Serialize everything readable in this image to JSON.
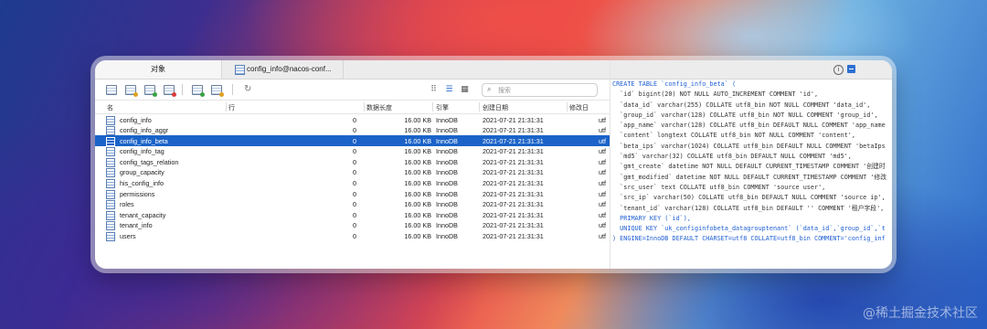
{
  "tabs": {
    "objects": "对象",
    "table_tab": "config_info@nacos-conf..."
  },
  "search": {
    "placeholder": "搜索"
  },
  "table": {
    "headers": {
      "name": "名",
      "rows": "行",
      "data_length": "数据长度",
      "engine": "引擎",
      "created": "创建日期",
      "modified": "修改日"
    },
    "rows": [
      {
        "name": "config_info",
        "rows": "0",
        "len": "16.00 KB",
        "engine": "InnoDB",
        "created": "2021-07-21 21:31:31",
        "mod": "utf"
      },
      {
        "name": "config_info_aggr",
        "rows": "0",
        "len": "16.00 KB",
        "engine": "InnoDB",
        "created": "2021-07-21 21:31:31",
        "mod": "utf"
      },
      {
        "name": "config_info_beta",
        "rows": "0",
        "len": "16.00 KB",
        "engine": "InnoDB",
        "created": "2021-07-21 21:31:31",
        "mod": "utf",
        "selected": true
      },
      {
        "name": "config_info_tag",
        "rows": "0",
        "len": "16.00 KB",
        "engine": "InnoDB",
        "created": "2021-07-21 21:31:31",
        "mod": "utf"
      },
      {
        "name": "config_tags_relation",
        "rows": "0",
        "len": "16.00 KB",
        "engine": "InnoDB",
        "created": "2021-07-21 21:31:31",
        "mod": "utf"
      },
      {
        "name": "group_capacity",
        "rows": "0",
        "len": "16.00 KB",
        "engine": "InnoDB",
        "created": "2021-07-21 21:31:31",
        "mod": "utf"
      },
      {
        "name": "his_config_info",
        "rows": "0",
        "len": "16.00 KB",
        "engine": "InnoDB",
        "created": "2021-07-21 21:31:31",
        "mod": "utf"
      },
      {
        "name": "permissions",
        "rows": "0",
        "len": "16.00 KB",
        "engine": "InnoDB",
        "created": "2021-07-21 21:31:31",
        "mod": "utf"
      },
      {
        "name": "roles",
        "rows": "0",
        "len": "16.00 KB",
        "engine": "InnoDB",
        "created": "2021-07-21 21:31:31",
        "mod": "utf"
      },
      {
        "name": "tenant_capacity",
        "rows": "0",
        "len": "16.00 KB",
        "engine": "InnoDB",
        "created": "2021-07-21 21:31:31",
        "mod": "utf"
      },
      {
        "name": "tenant_info",
        "rows": "0",
        "len": "16.00 KB",
        "engine": "InnoDB",
        "created": "2021-07-21 21:31:31",
        "mod": "utf"
      },
      {
        "name": "users",
        "rows": "0",
        "len": "16.00 KB",
        "engine": "InnoDB",
        "created": "2021-07-21 21:31:31",
        "mod": "utf"
      }
    ]
  },
  "ddl": [
    "CREATE TABLE `config_info_beta` (",
    "  `id` bigint(20) NOT NULL AUTO_INCREMENT COMMENT 'id',",
    "  `data_id` varchar(255) COLLATE utf8_bin NOT NULL COMMENT 'data_id',",
    "  `group_id` varchar(128) COLLATE utf8_bin NOT NULL COMMENT 'group_id',",
    "  `app_name` varchar(128) COLLATE utf8_bin DEFAULT NULL COMMENT 'app_name",
    "  `content` longtext COLLATE utf8_bin NOT NULL COMMENT 'content',",
    "  `beta_ips` varchar(1024) COLLATE utf8_bin DEFAULT NULL COMMENT 'betaIps",
    "  `md5` varchar(32) COLLATE utf8_bin DEFAULT NULL COMMENT 'md5',",
    "  `gmt_create` datetime NOT NULL DEFAULT CURRENT_TIMESTAMP COMMENT '创建时",
    "  `gmt_modified` datetime NOT NULL DEFAULT CURRENT_TIMESTAMP COMMENT '修改",
    "  `src_user` text COLLATE utf8_bin COMMENT 'source user',",
    "  `src_ip` varchar(50) COLLATE utf8_bin DEFAULT NULL COMMENT 'source ip',",
    "  `tenant_id` varchar(128) COLLATE utf8_bin DEFAULT '' COMMENT '租户字段',",
    "  PRIMARY KEY (`id`),",
    "  UNIQUE KEY `uk_configinfobeta_datagrouptenant` (`data_id`,`group_id`,`t",
    ") ENGINE=InnoDB DEFAULT CHARSET=utf8 COLLATE=utf8_bin COMMENT='config_inf"
  ],
  "watermark": "@稀土掘金技术社区",
  "icons": {
    "toolbar": [
      "open-table-icon",
      "design-table-icon",
      "new-table-icon",
      "delete-table-icon",
      "import-icon",
      "export-icon",
      "refresh-icon"
    ],
    "views": [
      "grid-view-icon",
      "list-view-icon",
      "detail-view-icon"
    ],
    "right": [
      "info-icon",
      "ddl-panel-icon"
    ]
  }
}
